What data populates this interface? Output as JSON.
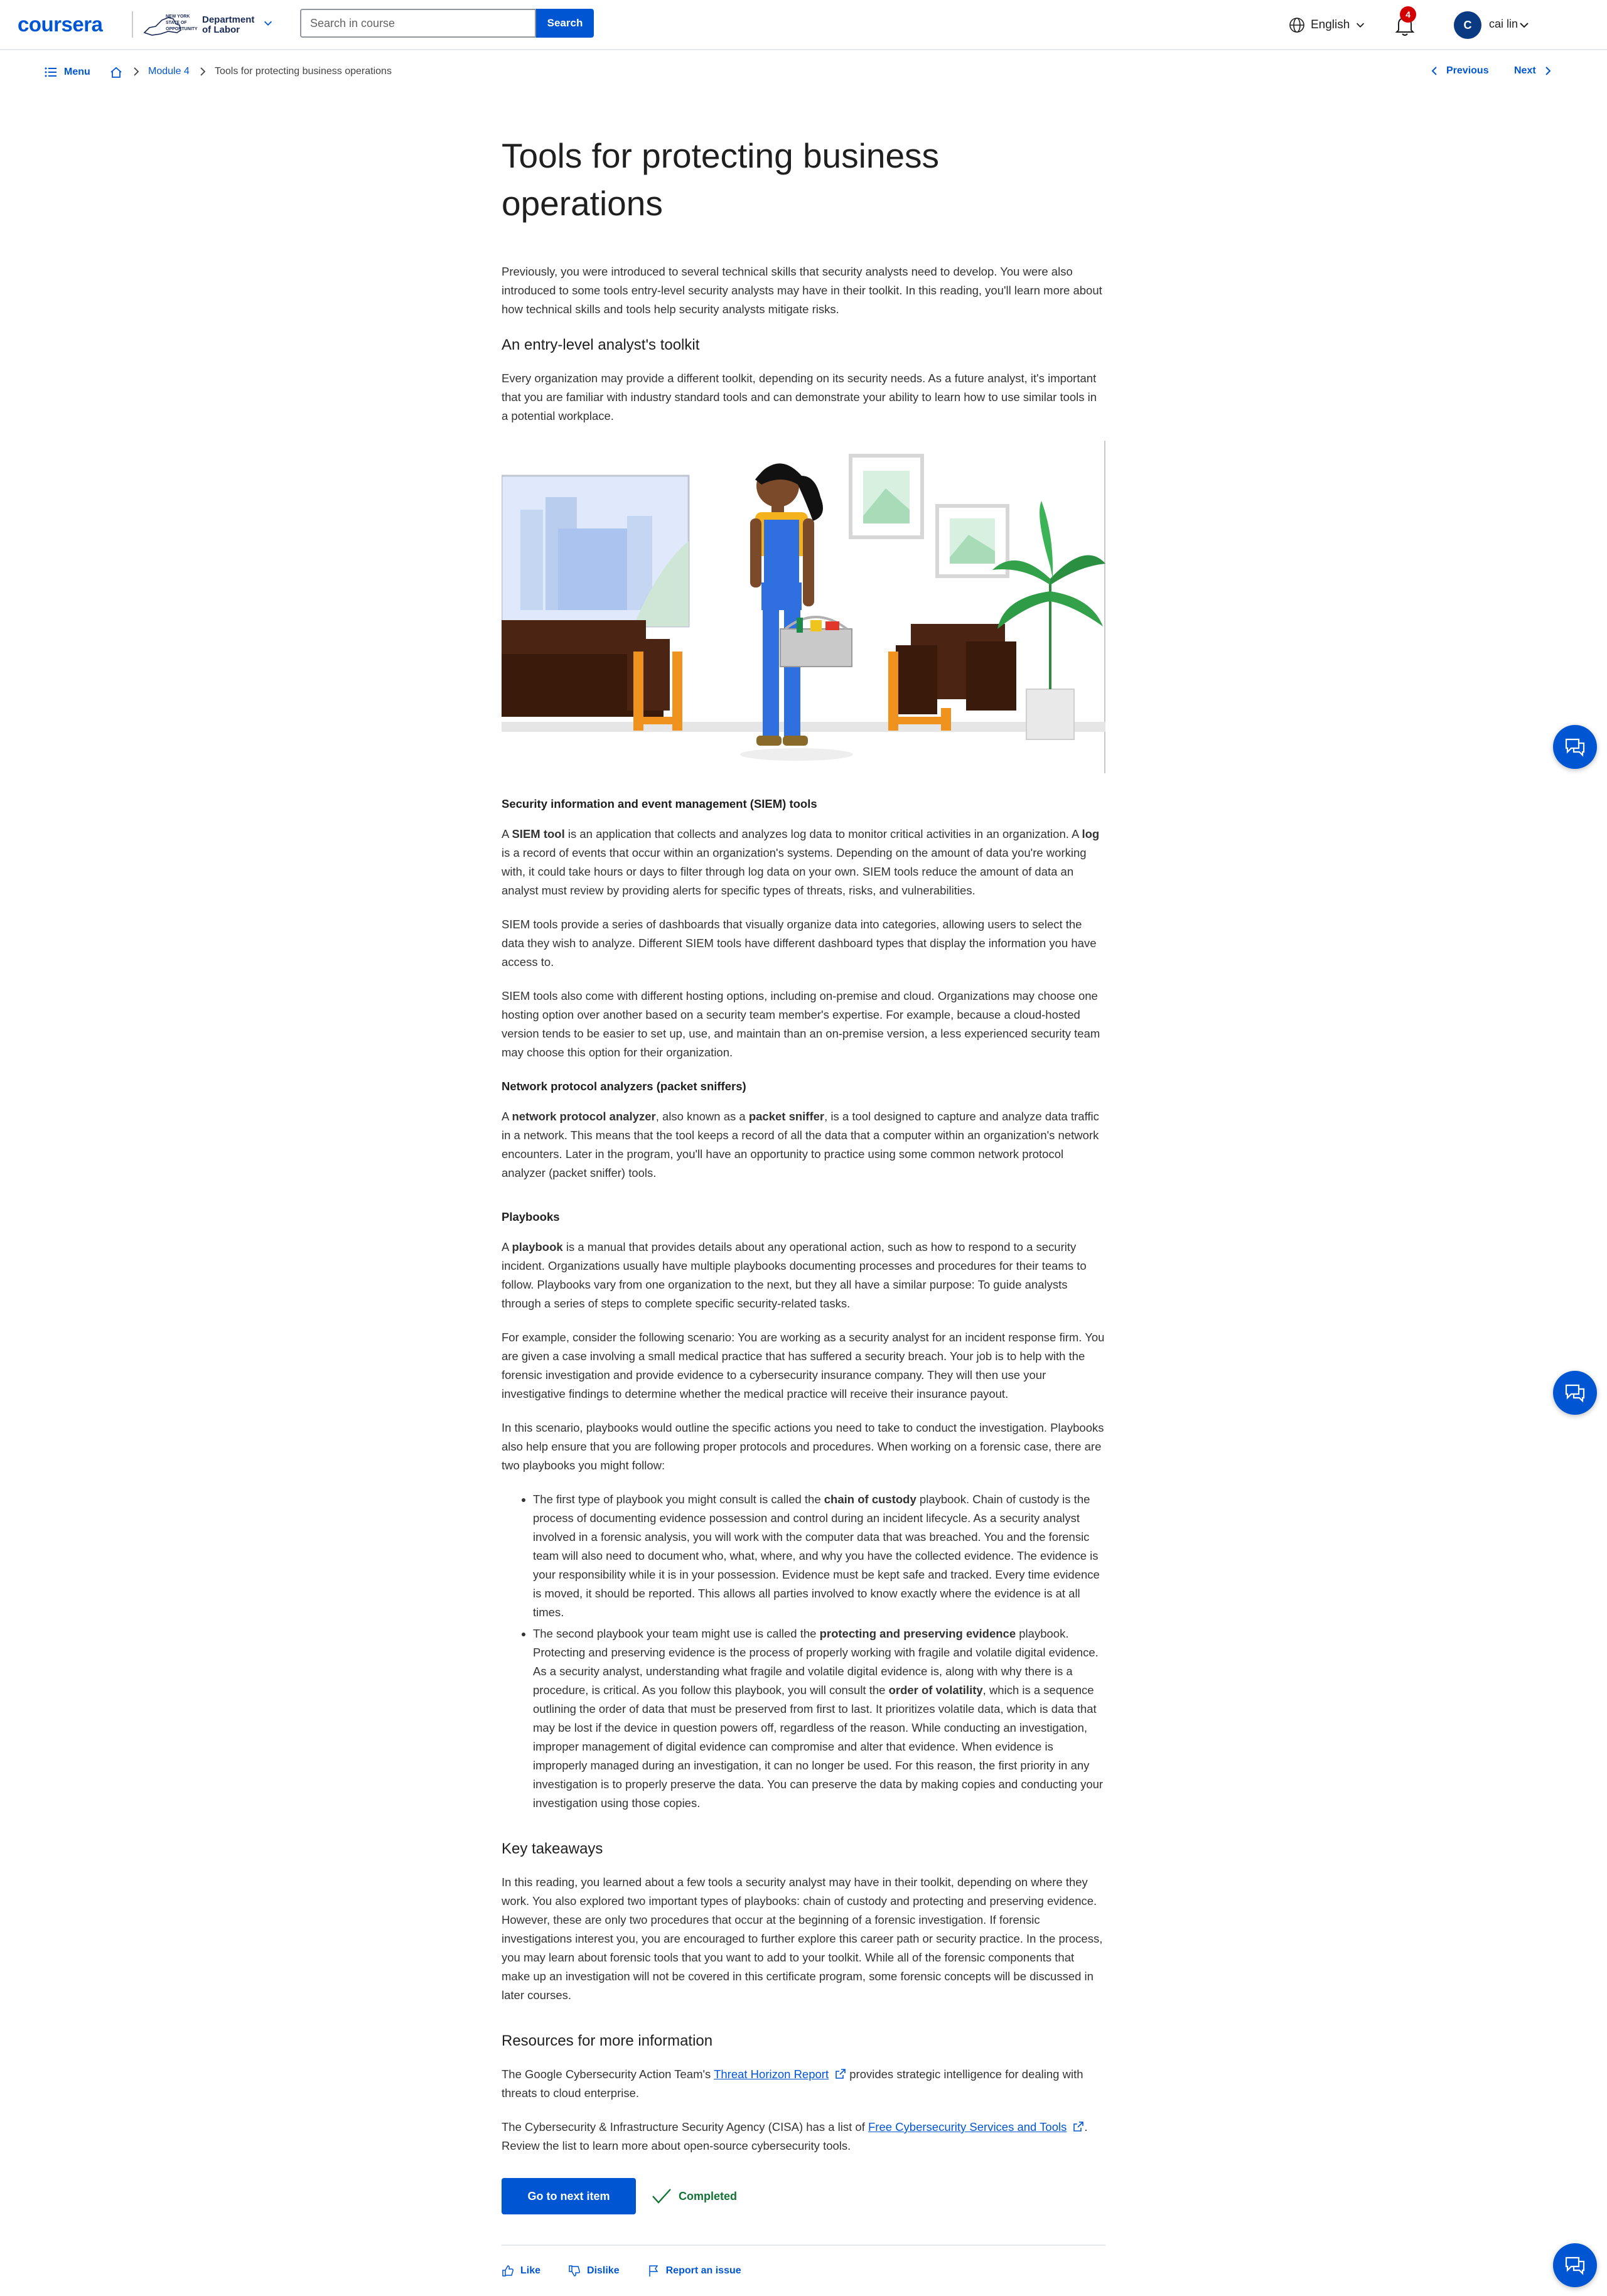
{
  "header": {
    "logo": "coursera",
    "partner_small": "NEW YORK STATE OF OPPORTUNITY",
    "partner_name_line1": "Department",
    "partner_name_line2": "of Labor",
    "search_placeholder": "Search in course",
    "search_button": "Search",
    "language": "English",
    "notification_count": "4",
    "avatar_initial": "C",
    "user_name": "cai lin"
  },
  "nav": {
    "menu": "Menu",
    "breadcrumb_module": "Module 4",
    "breadcrumb_current": "Tools for protecting business operations",
    "previous": "Previous",
    "next": "Next"
  },
  "article": {
    "title": "Tools for protecting business operations",
    "intro": "Previously, you were introduced to several technical skills that security analysts need to develop. You were also introduced to some tools entry-level security analysts may have in their toolkit. In this reading, you'll learn more about how technical skills and tools help security analysts mitigate risks.",
    "toolkit_heading": "An entry-level analyst's toolkit",
    "toolkit_text": "Every organization may provide a different toolkit, depending on its security needs. As a future analyst, it's important that you are familiar with industry standard tools and can demonstrate your ability to learn how to use similar tools in a potential workplace.",
    "siem_heading": "Security information and event management (SIEM) tools",
    "siem_p1_a": "A ",
    "siem_p1_term1": "SIEM tool",
    "siem_p1_b": " is an application that collects and analyzes log data to monitor critical activities in an organization. A ",
    "siem_p1_term2": "log",
    "siem_p1_c": " is a record of events that occur within an organization's systems. Depending on the amount of data you're working with, it could take hours or days to filter through log data on your own. SIEM tools reduce the amount of data an analyst must review by providing alerts for specific types of threats, risks, and vulnerabilities.",
    "siem_p2": "SIEM tools provide a series of dashboards that visually organize data into categories, allowing users to select the data they wish to analyze. Different SIEM tools have different dashboard types that display the information you have access to.",
    "siem_p3": "SIEM tools also come with different hosting options, including on-premise and cloud. Organizations may choose one hosting option over another based on a security team member's expertise. For example, because a cloud-hosted version tends to be easier to set up, use, and maintain than an on-premise version, a less experienced security team may choose this option for their organization.",
    "npa_heading": "Network protocol analyzers (packet sniffers)",
    "npa_a": "A ",
    "npa_term1": "network protocol analyzer",
    "npa_b": ", also known as a ",
    "npa_term2": "packet sniffer",
    "npa_c": ", is a tool designed to capture and analyze data traffic in a network. This means that the tool keeps a record of all the data that a computer within an organization's network encounters. Later in the program, you'll have an opportunity to practice using some common network protocol analyzer (packet sniffer) tools.",
    "playbooks_heading": "Playbooks",
    "pb_p1_a": "A ",
    "pb_p1_term": "playbook",
    "pb_p1_b": " is a manual that provides details about any operational action, such as how to respond to a security incident. Organizations usually have multiple playbooks documenting processes and procedures for their teams to follow. Playbooks vary from one organization to the next, but they all have a similar purpose: To guide analysts through a series of steps to complete specific security-related tasks.",
    "pb_p2": "For example, consider the following scenario: You are working as a security analyst for an incident response firm. You are given a case involving a small medical practice that has suffered a security breach. Your job is to help with the forensic investigation and provide evidence to a cybersecurity insurance company. They will then use your investigative findings to determine whether the medical practice will receive their insurance payout.",
    "pb_p3": "In this scenario, playbooks would outline the specific actions you need to take to conduct the investigation. Playbooks also help ensure that you are following proper protocols and procedures. When working on a forensic case, there are two playbooks you might follow:",
    "li1_a": "The first type of playbook you might consult is called the ",
    "li1_term": "chain of custody",
    "li1_b": " playbook. Chain of custody is the process of documenting evidence possession and control during an incident lifecycle. As a security analyst involved in a forensic analysis, you will work with the computer data that was breached. You and the forensic team will also need to document who, what, where, and why you have the collected evidence. The evidence is your responsibility while it is in your possession. Evidence must be kept safe and tracked. Every time evidence is moved, it should be reported. This allows all parties involved to know exactly where the evidence is at all times.",
    "li2_a": "The second playbook your team might use is called the ",
    "li2_term1": "protecting and preserving evidence",
    "li2_b": " playbook. Protecting and preserving evidence is the process of properly working with fragile and volatile digital evidence. As a security analyst, understanding what fragile and volatile digital evidence is, along with why there is a procedure, is critical. As you follow this playbook, you will consult the ",
    "li2_term2": "order of volatility",
    "li2_c": ", which is a sequence outlining the order of data that must be preserved from first to last. It prioritizes volatile data, which is data that may be lost if the device in question powers off, regardless of the reason. While conducting an investigation, improper management of digital evidence can compromise and alter that evidence. When evidence is improperly managed during an investigation, it can no longer be used. For this reason, the first priority in any investigation is to properly preserve the data. You can preserve the data by making copies and conducting your investigation using those copies.",
    "takeaways_heading": "Key takeaways",
    "takeaways_text": "In this reading, you learned about a few tools a security analyst may have in their toolkit, depending on where they work. You also explored two important types of playbooks: chain of custody and protecting and preserving evidence. However, these are only two procedures that occur at the beginning of a forensic investigation. If forensic investigations interest you, you are encouraged to further explore this career path or security practice. In the process, you may learn about forensic tools that you want to add to your toolkit. While all of the forensic components that make up an investigation will not be covered in this certificate program, some forensic concepts will be discussed in later courses.",
    "resources_heading": "Resources for more information",
    "res1_a": "The Google Cybersecurity Action Team's ",
    "res1_link": "Threat Horizon Report",
    "res1_b": " provides strategic intelligence for dealing with threats to cloud enterprise.",
    "res2_a": "The Cybersecurity & Infrastructure Security Agency (CISA) has a list of ",
    "res2_link": "Free Cybersecurity Services and Tools",
    "res2_b": ". Review the list to learn more about open-source cybersecurity tools."
  },
  "footer": {
    "next_item": "Go to next item",
    "completed": "Completed",
    "like": "Like",
    "dislike": "Dislike",
    "report": "Report an issue"
  },
  "colors": {
    "brand": "#0056d2",
    "completed": "#137333",
    "badge": "#d30001"
  }
}
